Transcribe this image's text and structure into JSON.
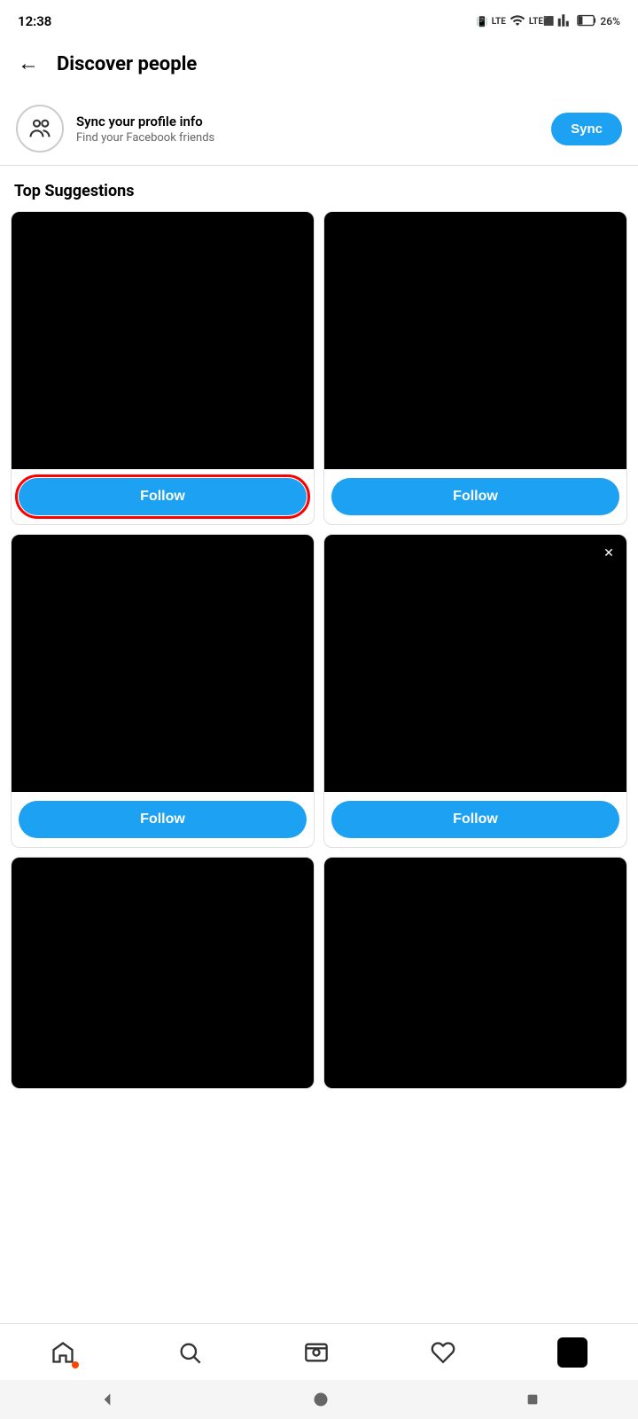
{
  "statusBar": {
    "time": "12:38",
    "battery": "26%"
  },
  "header": {
    "backLabel": "←",
    "title": "Discover people"
  },
  "syncBanner": {
    "title": "Sync your profile info",
    "subtitle": "Find your Facebook friends",
    "buttonLabel": "Sync"
  },
  "topSuggestions": {
    "sectionTitle": "Top Suggestions"
  },
  "cards": [
    {
      "id": 1,
      "followLabel": "Follow",
      "highlighted": true,
      "hasDismiss": false
    },
    {
      "id": 2,
      "followLabel": "Follow",
      "highlighted": false,
      "hasDismiss": false
    },
    {
      "id": 3,
      "followLabel": "Follow",
      "highlighted": false,
      "hasDismiss": false
    },
    {
      "id": 4,
      "followLabel": "Follow",
      "highlighted": false,
      "hasDismiss": true
    },
    {
      "id": 5,
      "followLabel": null,
      "highlighted": false,
      "hasDismiss": false
    },
    {
      "id": 6,
      "followLabel": null,
      "highlighted": false,
      "hasDismiss": false
    }
  ],
  "bottomNav": {
    "items": [
      {
        "name": "home",
        "icon": "home-icon"
      },
      {
        "name": "search",
        "icon": "search-icon"
      },
      {
        "name": "reels",
        "icon": "reels-icon"
      },
      {
        "name": "activity",
        "icon": "heart-icon"
      },
      {
        "name": "profile",
        "icon": "profile-avatar"
      }
    ]
  },
  "androidBar": {
    "back": "◀",
    "home": "●",
    "recent": "■"
  },
  "colors": {
    "accent": "#1da1f2",
    "highlight": "#ff0000",
    "cardBg": "#000000"
  }
}
